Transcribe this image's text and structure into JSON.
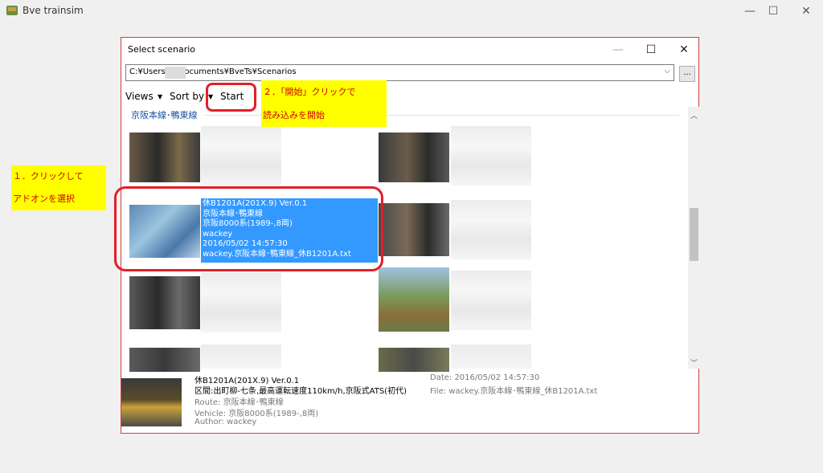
{
  "app": {
    "title": "Bve trainsim"
  },
  "window_controls": {
    "minimize": "—",
    "maximize": "☐",
    "close": "✕"
  },
  "dialog": {
    "title": "Select scenario",
    "controls": {
      "minimize": "—",
      "maximize": "☐",
      "close": "✕"
    },
    "path": "C:¥Users¥        ¥Documents¥BveTs¥Scenarios",
    "browse_label": "...",
    "toolbar": {
      "views": "Views",
      "sort_by": "Sort by",
      "start": "Start"
    },
    "group_label": "京阪本線･鴨東線",
    "selected_item": {
      "lines": [
        "休B1201A(201X.9) Ver.0.1",
        "京阪本線･鴨東線",
        "京阪8000系(1989-,8両)",
        "wackey",
        "2016/05/02 14:57:30",
        "wackey.京阪本線･鴨東線_休B1201A.txt"
      ]
    },
    "details": {
      "title": "休B1201A(201X.9) Ver.0.1",
      "description": "区間:出町柳-七条,最高運転速度110km/h,京阪式ATS(初代)",
      "route": "Route: 京阪本線･鴨東線",
      "vehicle": "Vehicle: 京阪8000系(1989-,8両)",
      "author": "Author: wackey",
      "date": "Date: 2016/05/02 14:57:30",
      "file": "File: wackey.京阪本線･鴨東線_休B1201A.txt"
    }
  },
  "annotations": {
    "step1_line1": "１．クリックして",
    "step1_line2": "アドオンを選択",
    "step2_line1": "２．「開始」クリックで",
    "step2_line2": "読み込みを開始"
  },
  "colors": {
    "selection": "#3399ff",
    "annotation_bg": "#ffff00",
    "annotation_text": "#d00000",
    "highlight_border": "#e0202a"
  }
}
